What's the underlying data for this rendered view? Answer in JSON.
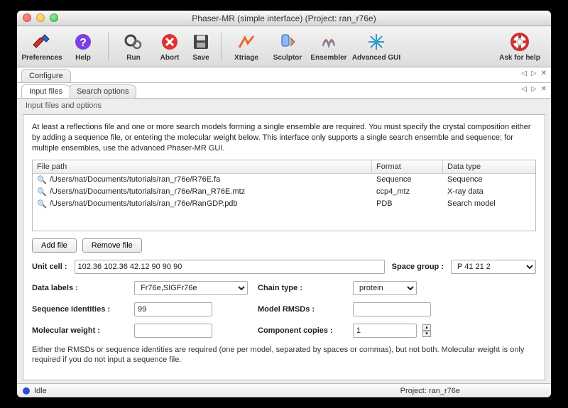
{
  "window": {
    "title": "Phaser-MR (simple interface) (Project: ran_r76e)"
  },
  "toolbar": {
    "preferences": "Preferences",
    "help": "Help",
    "run": "Run",
    "abort": "Abort",
    "save": "Save",
    "xtriage": "Xtriage",
    "sculptor": "Sculptor",
    "ensembler": "Ensembler",
    "advanced": "Advanced GUI",
    "askhelp": "Ask for help"
  },
  "tabs": {
    "configure": "Configure",
    "input_files": "Input files",
    "search_options": "Search options"
  },
  "panel": {
    "section": "Input files and options",
    "desc": "At least a reflections file and one or more search models forming a single ensemble are required.  You must specify the crystal composition either by adding a sequence file, or entering the molecular weight below.  This interface only supports a single search ensemble and sequence; for multiple ensembles, use the advanced Phaser-MR GUI.",
    "headers": {
      "path": "File path",
      "format": "Format",
      "datatype": "Data type"
    },
    "files": [
      {
        "path": "/Users/nat/Documents/tutorials/ran_r76e/R76E.fa",
        "format": "Sequence",
        "datatype": "Sequence"
      },
      {
        "path": "/Users/nat/Documents/tutorials/ran_r76e/Ran_R76E.mtz",
        "format": "ccp4_mtz",
        "datatype": "X-ray data"
      },
      {
        "path": "/Users/nat/Documents/tutorials/ran_r76e/RanGDP.pdb",
        "format": "PDB",
        "datatype": "Search model"
      }
    ],
    "buttons": {
      "add": "Add file",
      "remove": "Remove file"
    },
    "labels": {
      "unitcell": "Unit cell :",
      "spacegroup": "Space group :",
      "datalabels": "Data labels :",
      "chaintype": "Chain type :",
      "seqid": "Sequence identities :",
      "rmsd": "Model RMSDs :",
      "molwt": "Molecular weight :",
      "copies": "Component copies :"
    },
    "values": {
      "unitcell": "102.36 102.36 42.12 90 90 90",
      "spacegroup": "P 41 21 2",
      "datalabels": "Fr76e,SIGFr76e",
      "chaintype": "protein",
      "seqid": "99",
      "rmsd": "",
      "molwt": "",
      "copies": "1"
    },
    "note": "Either the RMSDs or sequence identities are required (one per model, separated by spaces or commas), but not both.  Molecular weight is only required if you do not input a sequence file."
  },
  "status": {
    "state": "Idle",
    "project": "Project: ran_r76e"
  }
}
